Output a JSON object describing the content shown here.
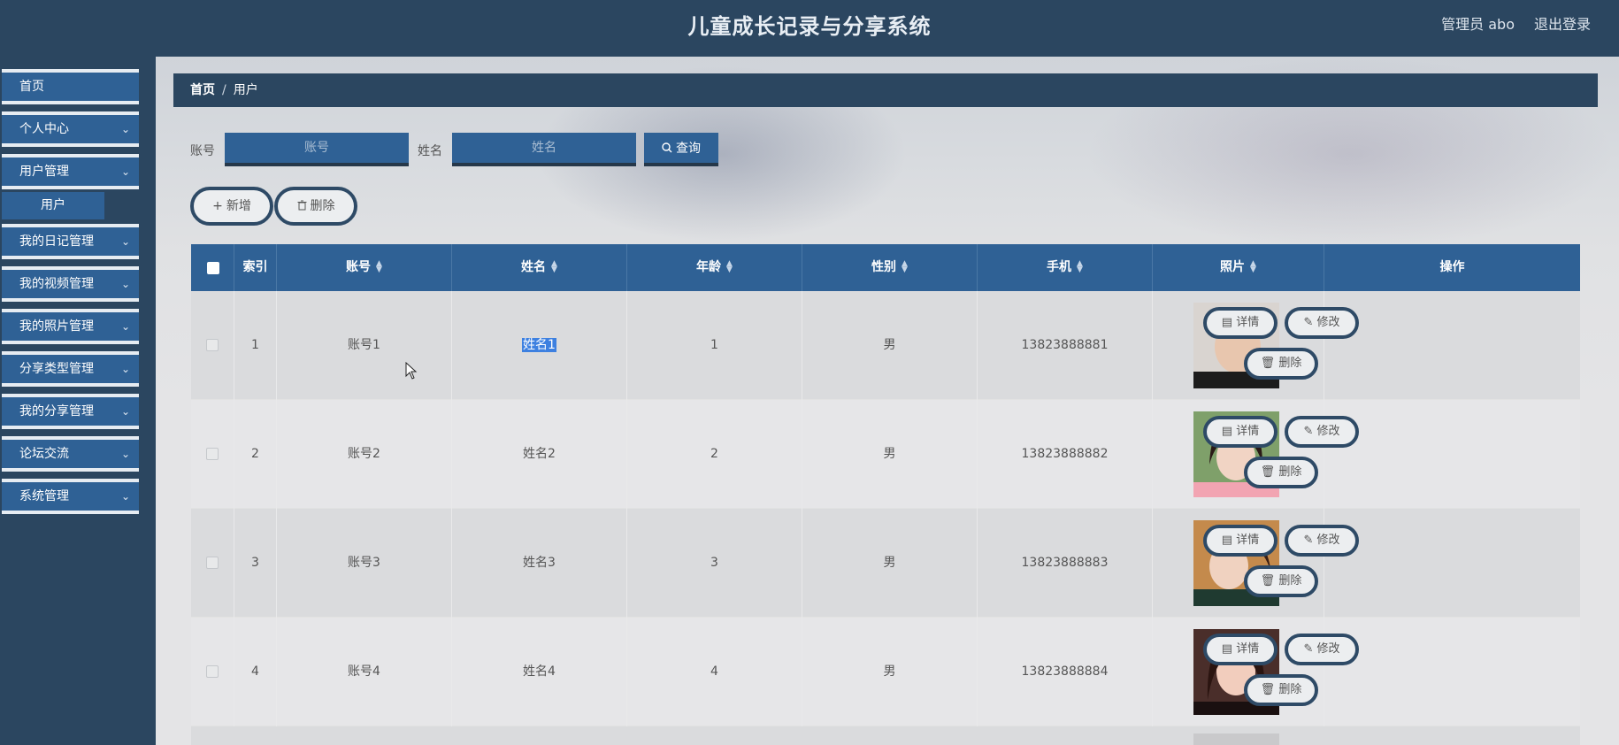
{
  "header": {
    "title": "儿童成长记录与分享系统",
    "user": "管理员 abo",
    "logout": "退出登录"
  },
  "sidebar": {
    "items": [
      {
        "label": "首页",
        "has_children": false
      },
      {
        "label": "个人中心",
        "has_children": true
      },
      {
        "label": "用户管理",
        "has_children": true
      },
      {
        "label": "我的日记管理",
        "has_children": true
      },
      {
        "label": "我的视频管理",
        "has_children": true
      },
      {
        "label": "我的照片管理",
        "has_children": true
      },
      {
        "label": "分享类型管理",
        "has_children": true
      },
      {
        "label": "我的分享管理",
        "has_children": true
      },
      {
        "label": "论坛交流",
        "has_children": true
      },
      {
        "label": "系统管理",
        "has_children": true
      }
    ],
    "submenu": {
      "label": "用户"
    }
  },
  "breadcrumb": {
    "home": "首页",
    "separator": "/",
    "current": "用户"
  },
  "search": {
    "account_label": "账号",
    "account_placeholder": "账号",
    "name_label": "姓名",
    "name_placeholder": "姓名",
    "query_label": "查询"
  },
  "actions": {
    "add_label": "新增",
    "delete_label": "删除"
  },
  "table": {
    "headers": {
      "index": "索引",
      "account": "账号",
      "name": "姓名",
      "age": "年龄",
      "gender": "性别",
      "phone": "手机",
      "photo": "照片",
      "operation": "操作"
    },
    "row_actions": {
      "detail": "详情",
      "edit": "修改",
      "delete": "删除"
    },
    "rows": [
      {
        "index": "1",
        "account": "账号1",
        "name": "姓名1",
        "age": "1",
        "gender": "男",
        "phone": "13823888881"
      },
      {
        "index": "2",
        "account": "账号2",
        "name": "姓名2",
        "age": "2",
        "gender": "男",
        "phone": "13823888882"
      },
      {
        "index": "3",
        "account": "账号3",
        "name": "姓名3",
        "age": "3",
        "gender": "男",
        "phone": "13823888883"
      },
      {
        "index": "4",
        "account": "账号4",
        "name": "姓名4",
        "age": "4",
        "gender": "男",
        "phone": "13823888884"
      }
    ]
  },
  "colors": {
    "nav_dark": "#2b4660",
    "nav_blue": "#2f6195",
    "pill_border": "#2e4a66",
    "selection": "#3d80e0"
  }
}
